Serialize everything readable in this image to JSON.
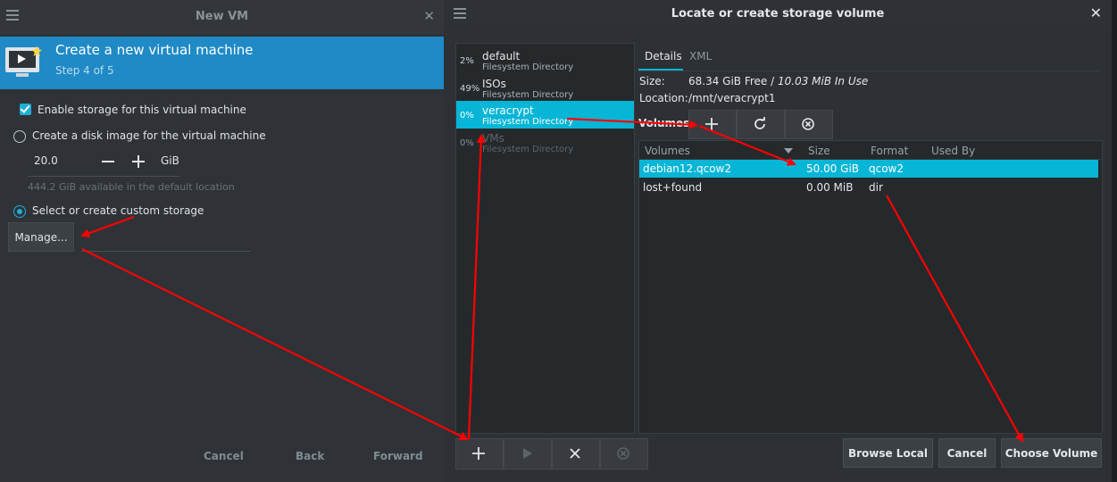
{
  "left_window": {
    "title": "New VM",
    "close_glyph": "✕",
    "banner_title": "Create a new virtual machine",
    "banner_step": "Step 4 of 5",
    "enable_storage_label": "Enable storage for this virtual machine",
    "enable_storage_checked": true,
    "create_disk_label": "Create a disk image for the virtual machine",
    "disk_size_value": "20.0",
    "disk_unit": "GiB",
    "available_text": "444.2 GiB available in the default location",
    "custom_storage_label": "Select or create custom storage",
    "selected_option": "custom",
    "manage_button": "Manage...",
    "cancel": "Cancel",
    "back": "Back",
    "forward": "Forward"
  },
  "dialog": {
    "title": "Locate or create storage volume",
    "close_glyph": "✕",
    "pools": [
      {
        "pct": "2%",
        "name": "default",
        "type": "Filesystem Directory"
      },
      {
        "pct": "49%",
        "name": "ISOs",
        "type": "Filesystem Directory"
      },
      {
        "pct": "0%",
        "name": "veracrypt",
        "type": "Filesystem Directory"
      },
      {
        "pct": "0%",
        "name": "VMs",
        "type": "Filesystem Directory"
      }
    ],
    "selected_pool": "veracrypt",
    "tabs": {
      "details": "Details",
      "xml": "XML"
    },
    "size_label": "Size:",
    "size_free": "68.34 GiB Free",
    "size_sep": " / ",
    "size_inuse": "10.03 MiB In Use",
    "location_label": "Location:",
    "location_value": "/mnt/veracrypt1",
    "volumes_label": "Volumes",
    "columns": {
      "volumes": "Volumes",
      "size": "Size",
      "format": "Format",
      "used_by": "Used By"
    },
    "volumes": [
      {
        "name": "debian12.qcow2",
        "size": "50.00 GiB",
        "format": "qcow2",
        "used_by": ""
      },
      {
        "name": "lost+found",
        "size": "0.00 MiB",
        "format": "dir",
        "used_by": ""
      }
    ],
    "selected_volume": "debian12.qcow2",
    "browse_local": "Browse Local",
    "cancel": "Cancel",
    "choose_volume": "Choose Volume"
  },
  "colors": {
    "accent": "#07b5d6",
    "banner": "#1f8ac6",
    "annotation_arrow": "#ff0000"
  }
}
